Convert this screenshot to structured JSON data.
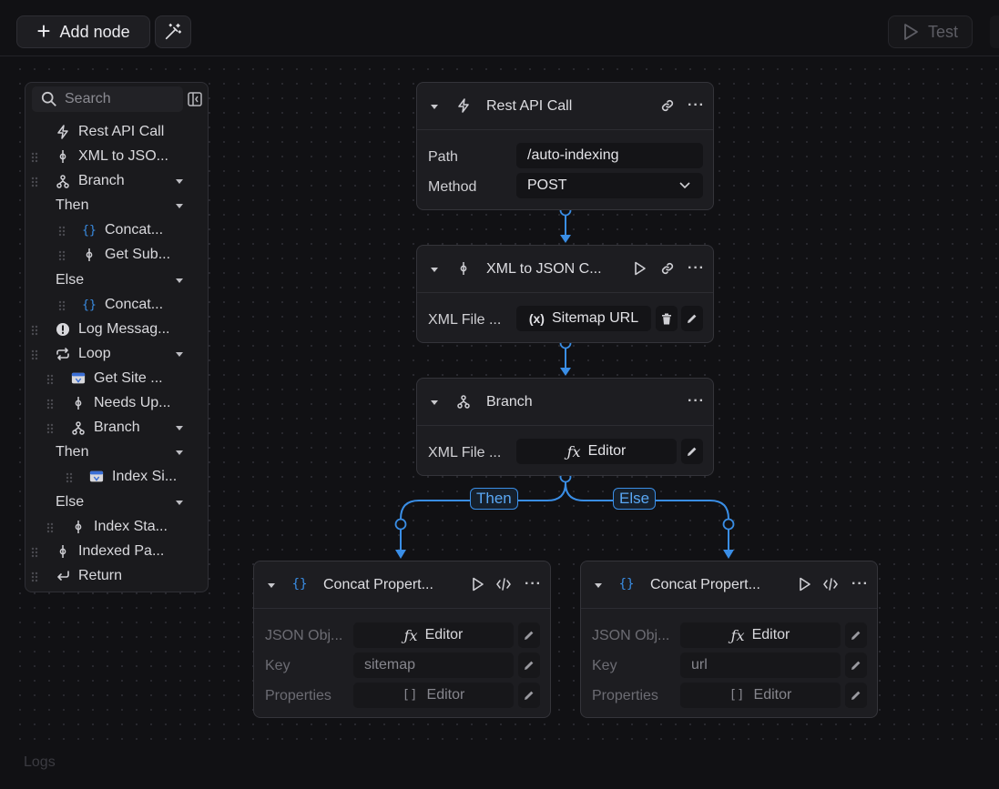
{
  "toolbar": {
    "add_node_label": "Add node",
    "test_label": "Test"
  },
  "sidebar": {
    "search_placeholder": "Search",
    "items": [
      {
        "label": "Rest API Call",
        "icon": "bolt-icon"
      },
      {
        "label": "XML to JSO...",
        "icon": "transform-icon"
      },
      {
        "label": "Branch",
        "icon": "branch-icon"
      },
      {
        "label": "Then"
      },
      {
        "label": "Concat...",
        "icon": "braces-icon"
      },
      {
        "label": "Get Sub...",
        "icon": "transform-icon"
      },
      {
        "label": "Else"
      },
      {
        "label": "Concat...",
        "icon": "braces-icon"
      },
      {
        "label": "Log Messag...",
        "icon": "alert-icon"
      },
      {
        "label": "Loop",
        "icon": "loop-icon"
      },
      {
        "label": "Get Site ...",
        "icon": "site-icon"
      },
      {
        "label": "Needs Up...",
        "icon": "transform-icon"
      },
      {
        "label": "Branch",
        "icon": "branch-icon"
      },
      {
        "label": "Then"
      },
      {
        "label": "Index Si...",
        "icon": "site-icon"
      },
      {
        "label": "Else"
      },
      {
        "label": "Index Sta...",
        "icon": "transform-icon"
      },
      {
        "label": "Indexed Pa...",
        "icon": "transform-icon"
      },
      {
        "label": "Return",
        "icon": "return-icon"
      }
    ]
  },
  "nodes": {
    "rest": {
      "title": "Rest API Call",
      "path_label": "Path",
      "path_value": "/auto-indexing",
      "method_label": "Method",
      "method_value": "POST"
    },
    "xml": {
      "title": "XML to JSON C...",
      "xml_label": "XML File ...",
      "xml_value": "Sitemap URL",
      "xml_var_glyph": "(x)"
    },
    "branch": {
      "title": "Branch",
      "xml_label": "XML File ...",
      "xml_value": "Editor",
      "fx_glyph": "ƒx"
    },
    "concat_then": {
      "title": "Concat Propert...",
      "json_label": "JSON Obj...",
      "json_value": "Editor",
      "fx_glyph": "ƒx",
      "key_label": "Key",
      "key_value": "sitemap",
      "props_label": "Properties",
      "props_value": "Editor",
      "array_glyph": "[]"
    },
    "concat_else": {
      "title": "Concat Propert...",
      "json_label": "JSON Obj...",
      "json_value": "Editor",
      "fx_glyph": "ƒx",
      "key_label": "Key",
      "key_value": "url",
      "props_label": "Properties",
      "props_value": "Editor",
      "array_glyph": "[]"
    }
  },
  "edges": {
    "then_label": "Then",
    "else_label": "Else"
  },
  "logs_label": "Logs",
  "colors": {
    "accent": "#3a8ee6",
    "background": "#111114",
    "node_bg": "#1d1d21"
  }
}
